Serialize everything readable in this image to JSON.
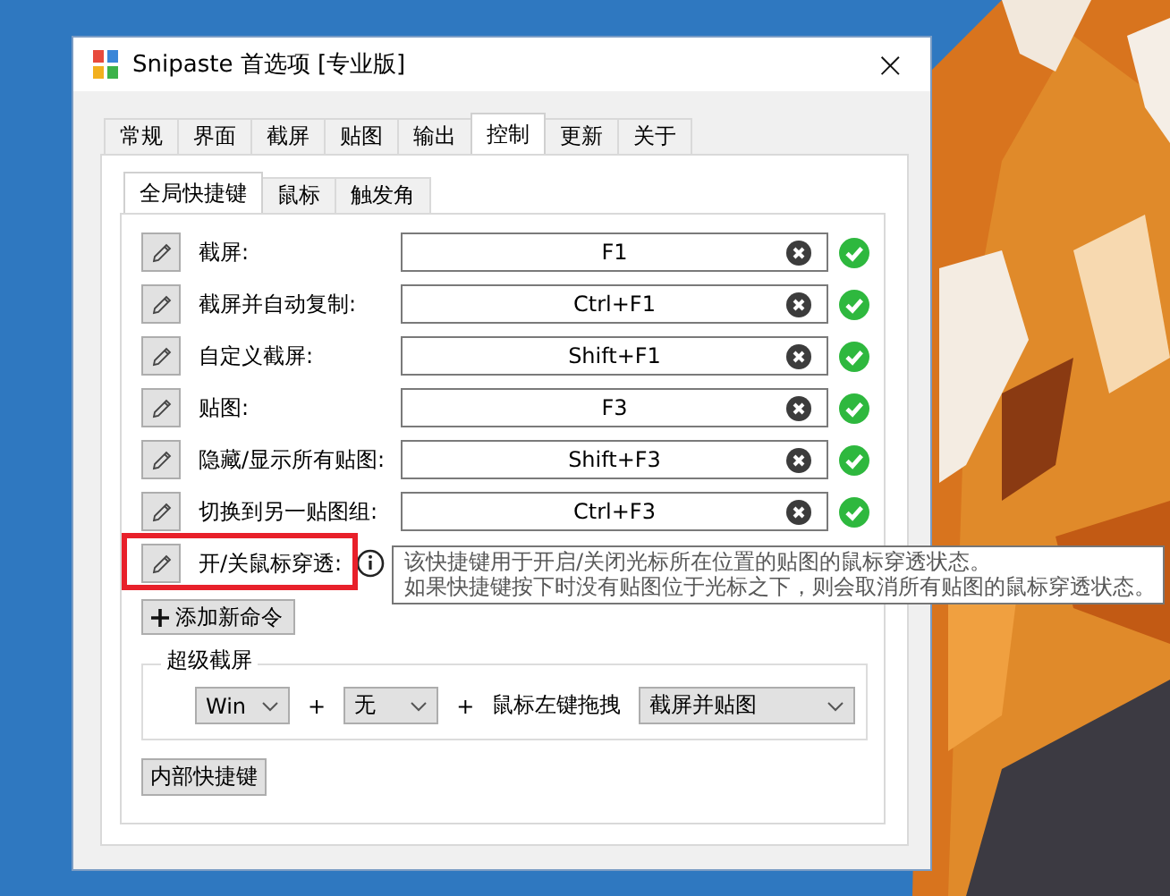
{
  "window": {
    "title": "Snipaste 首选项 [专业版]",
    "close": "×"
  },
  "tabs": [
    {
      "label": "常规",
      "selected": false
    },
    {
      "label": "界面",
      "selected": false
    },
    {
      "label": "截屏",
      "selected": false
    },
    {
      "label": "贴图",
      "selected": false
    },
    {
      "label": "输出",
      "selected": false
    },
    {
      "label": "控制",
      "selected": true
    },
    {
      "label": "更新",
      "selected": false
    },
    {
      "label": "关于",
      "selected": false
    }
  ],
  "subtabs": [
    {
      "label": "全局快捷键",
      "selected": true
    },
    {
      "label": "鼠标",
      "selected": false
    },
    {
      "label": "触发角",
      "selected": false
    }
  ],
  "shortcuts": [
    {
      "kind": "field",
      "label": "截屏:",
      "value": "F1",
      "valid": true,
      "highlighted": false
    },
    {
      "kind": "field",
      "label": "截屏并自动复制:",
      "value": "Ctrl+F1",
      "valid": true,
      "highlighted": false
    },
    {
      "kind": "field",
      "label": "自定义截屏:",
      "value": "Shift+F1",
      "valid": true,
      "highlighted": false
    },
    {
      "kind": "field",
      "label": "贴图:",
      "value": "F3",
      "valid": true,
      "highlighted": false
    },
    {
      "kind": "field",
      "label": "隐藏/显示所有贴图:",
      "value": "Shift+F3",
      "valid": true,
      "highlighted": false
    },
    {
      "kind": "field",
      "label": "切换到另一贴图组:",
      "value": "Ctrl+F3",
      "valid": true,
      "highlighted": false
    },
    {
      "kind": "info",
      "label": "开/关鼠标穿透:",
      "highlighted": true,
      "tooltip": [
        "该快捷键用于开启/关闭光标所在位置的贴图的鼠标穿透状态。",
        "如果快捷键按下时没有贴图位于光标之下，则会取消所有贴图的鼠标穿透状态。"
      ]
    }
  ],
  "add_button": "添加新命令",
  "super_screenshot": {
    "title": "超级截屏",
    "items": [
      {
        "kind": "combo",
        "value": "Win"
      },
      {
        "kind": "text",
        "value": "+"
      },
      {
        "kind": "combo",
        "value": "无"
      },
      {
        "kind": "text",
        "value": "+"
      },
      {
        "kind": "text",
        "value": "鼠标左键拖拽"
      },
      {
        "kind": "combo",
        "value": "截屏并贴图",
        "wide": true
      }
    ]
  },
  "internal_button": "内部快捷键"
}
